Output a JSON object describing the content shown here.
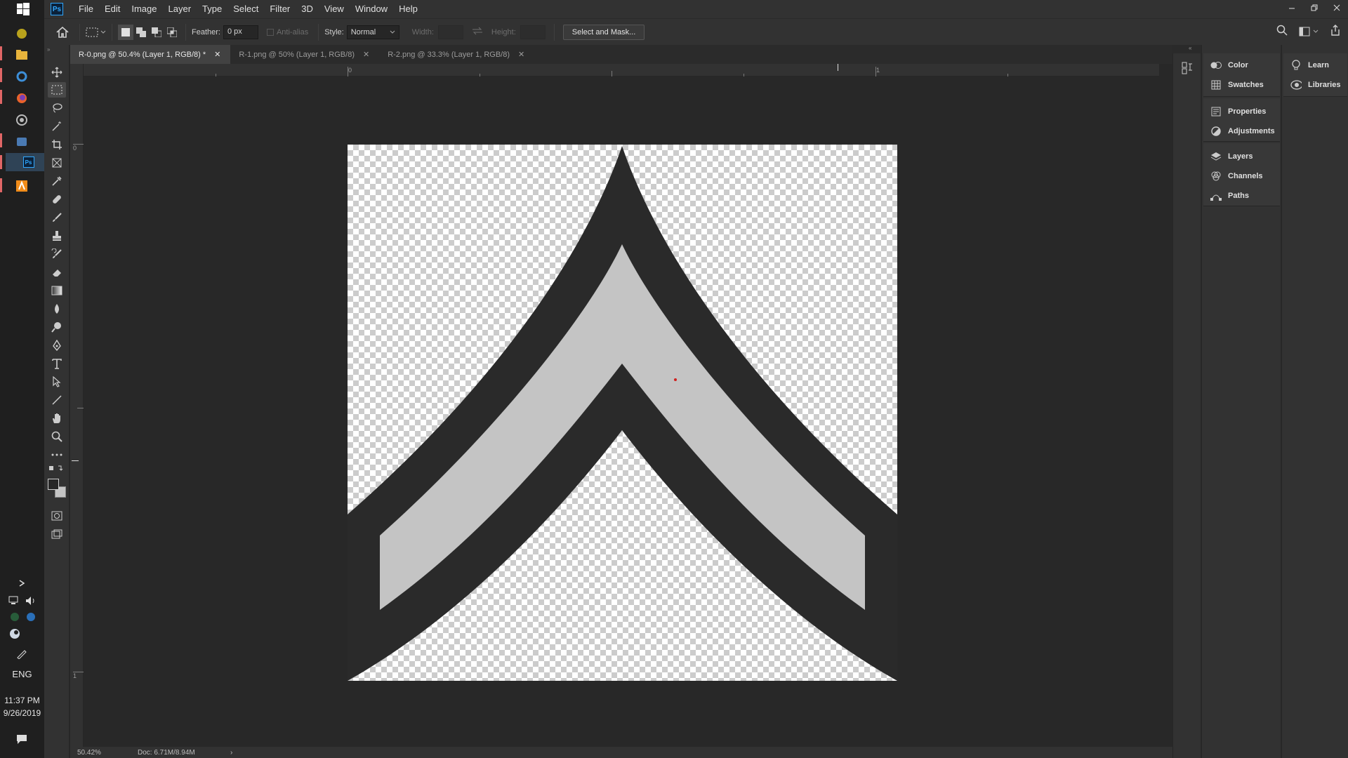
{
  "app": {
    "logo": "Ps"
  },
  "menu": [
    "File",
    "Edit",
    "Image",
    "Layer",
    "Type",
    "Select",
    "Filter",
    "3D",
    "View",
    "Window",
    "Help"
  ],
  "options": {
    "feather_label": "Feather:",
    "feather_value": "0 px",
    "antialias_label": "Anti-alias",
    "style_label": "Style:",
    "style_value": "Normal",
    "width_label": "Width:",
    "height_label": "Height:",
    "select_mask_label": "Select and Mask..."
  },
  "tabs": [
    {
      "label": "R-0.png @ 50.4% (Layer 1, RGB/8) *",
      "active": true
    },
    {
      "label": "R-1.png @ 50% (Layer 1, RGB/8)",
      "active": false
    },
    {
      "label": "R-2.png @ 33.3% (Layer 1, RGB/8)",
      "active": false
    }
  ],
  "rulers": {
    "h_labels": [
      "0",
      "1"
    ],
    "v_labels": [
      "0",
      "1"
    ]
  },
  "status": {
    "zoom": "50.42%",
    "doc": "Doc: 6.71M/8.94M"
  },
  "panels": {
    "group1": [
      "Color",
      "Swatches"
    ],
    "group2": [
      "Properties",
      "Adjustments"
    ],
    "group3": [
      "Layers",
      "Channels",
      "Paths"
    ],
    "group4": [
      "Learn",
      "Libraries"
    ]
  },
  "tray": {
    "lang": "ENG",
    "time": "11:37 PM",
    "date": "9/26/2019"
  },
  "colors": {
    "chevron_dark": "#2a2a2a",
    "chevron_light": "#c4c4c4",
    "accent": "#31a8ff"
  }
}
